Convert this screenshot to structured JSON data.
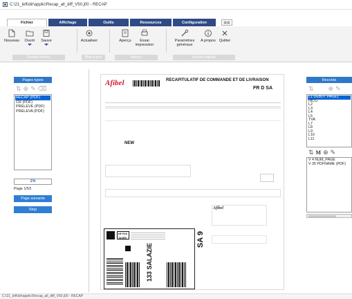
{
  "window": {
    "title": "C:\\21_left\\dir\\applic\\Recap_all_diff_V50.j00 - RECAP"
  },
  "tabs": [
    {
      "label": "Fichier"
    },
    {
      "label": "Affichage"
    },
    {
      "label": "Outils"
    },
    {
      "label": "Ressources"
    },
    {
      "label": "Configuration"
    }
  ],
  "ribbon": {
    "buttons": {
      "nouveau": "Nouveau",
      "ouvrir": "Ouvrir",
      "sauve": "Sauve",
      "actualiser": "Actualiser",
      "apercu": "Aperçu",
      "essai_impression": "Essai impression",
      "parametres_generaux": "Paramètres généraux",
      "a_propos": "A propos",
      "quitter": "Quitter"
    },
    "groups": {
      "g1": "Gestion fichiers",
      "g2": "Mise à jour",
      "g3": "Aperçu",
      "g4": "Gestion logiciel"
    }
  },
  "left_panel": {
    "header": "Pages types",
    "items": [
      "RECAP (PDF)",
      "CR (PDF)",
      "PRELEVE (PDF)",
      "PRELEVA (PDF)"
    ],
    "selected_index": 0,
    "progress": "1%",
    "page_counter": "Page 1/53",
    "next_page_label": "Page suivante",
    "stop_label": "Stop"
  },
  "document": {
    "logo": "Afibel",
    "title": "RECAPITULATIF DE COMMANDE ET DE LIVRAISON",
    "country": "FR D SA",
    "watermark": "NEW",
    "sa_code": "SA 9",
    "barcode_number": "133 SALAZIE",
    "label_tag": "NE PAS TAXER"
  },
  "right_panel": {
    "header": "Records",
    "items": [
      "L1 DEBUT PAGE1",
      "INCG",
      "L2",
      "L3",
      "L4",
      "L5",
      "TVA",
      "L7",
      "L8",
      "L9",
      "L10",
      "L11"
    ],
    "selected_index": 0,
    "m_label": "M",
    "sub_items": [
      "V 4 NUM_PAGE",
      "V 35 PDFNAME (PDF)"
    ]
  },
  "status": {
    "text": "C:\\21_left\\dir\\applic\\Recap_all_diff_V50.j00 - RECAP"
  },
  "colors": {
    "tab_dark": "#2f4a85",
    "panel_blue": "#2e78c8",
    "selection": "#0a64d4",
    "logo_red": "#d11d2a"
  }
}
